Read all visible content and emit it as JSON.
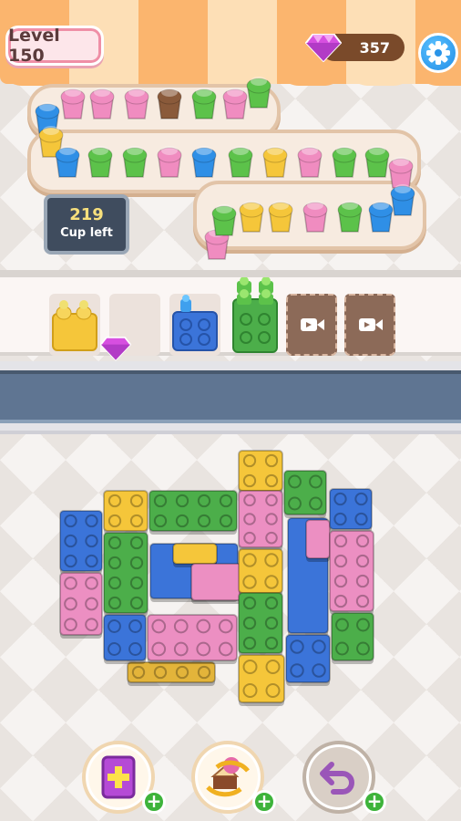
{
  "header": {
    "level_label": "Level 150",
    "gems": "357",
    "icons": {
      "gem": "gem-icon",
      "settings": "gear-icon"
    }
  },
  "conveyor": {
    "cups_left_count": "219",
    "cups_left_label": "Cup left",
    "colors": {
      "pink": "#f08cc0",
      "blue": "#2f8fe6",
      "green": "#5cc24a",
      "yellow": "#f5c63a",
      "brown": "#8a5a3a"
    }
  },
  "slots": {
    "items": [
      "yellow-brick",
      "empty",
      "blue-brick",
      "green-brick",
      "video-locked",
      "video-locked"
    ]
  },
  "powerups": [
    {
      "name": "add-card",
      "icon": "card-plus-icon"
    },
    {
      "name": "shuffle",
      "icon": "shuffle-cake-icon"
    },
    {
      "name": "undo",
      "icon": "undo-icon"
    }
  ],
  "palette": {
    "yellow": "#f5c63a",
    "blue": "#3b74d9",
    "green": "#4cae4a",
    "pink": "#ec8fc2",
    "plus": "#3db33a"
  }
}
